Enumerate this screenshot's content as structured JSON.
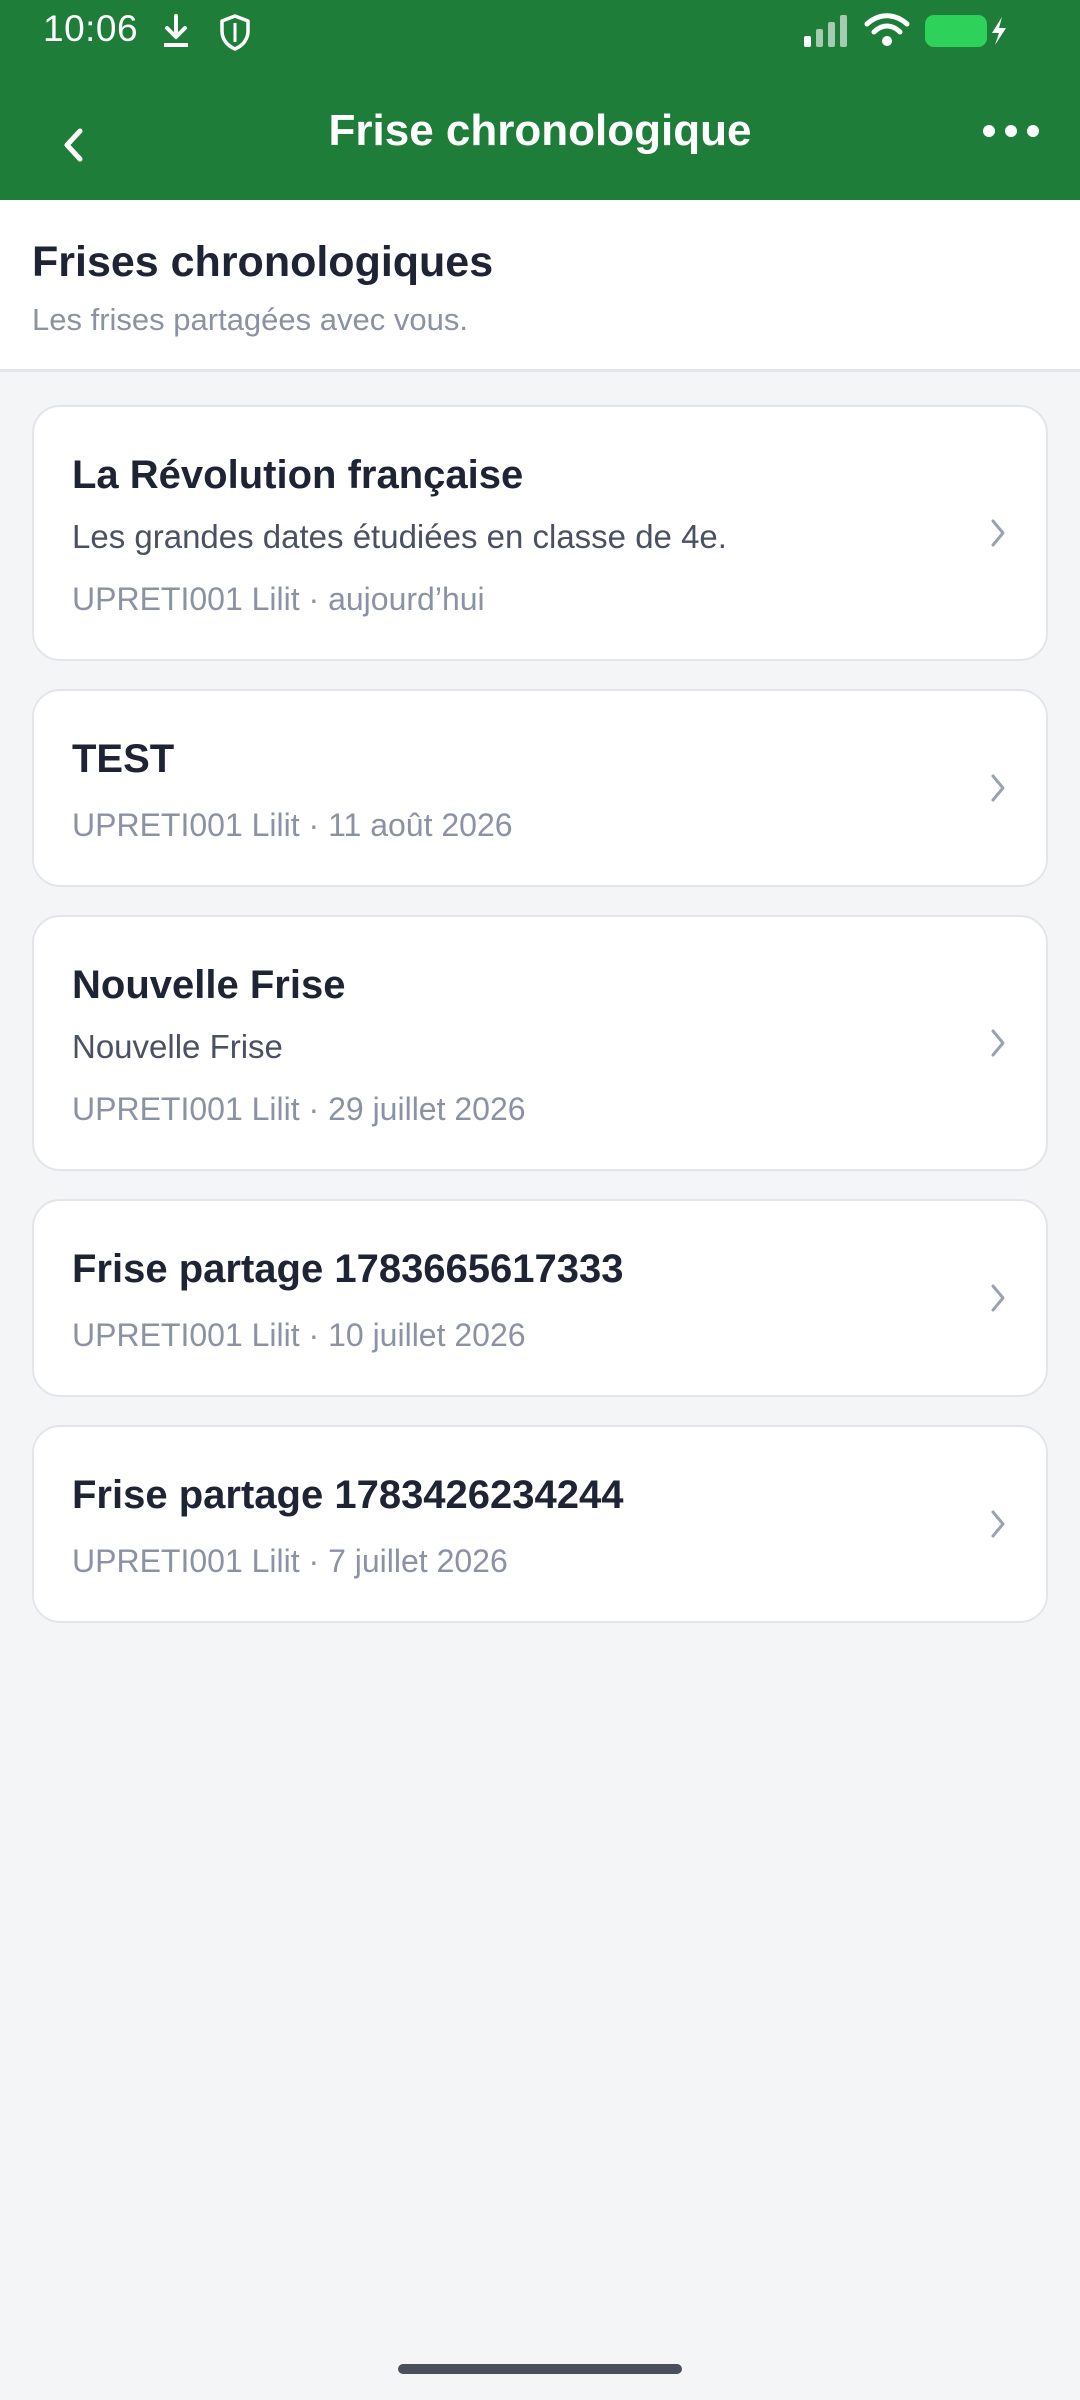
{
  "status_bar": {
    "time": "10:06",
    "icons": [
      "download-icon",
      "shield-icon",
      "signal-icon",
      "wifi-icon",
      "battery-charging-icon"
    ],
    "battery_color": "#2ed15a"
  },
  "app_bar": {
    "title": "Frise chronologique",
    "back_icon": "back-chevron-icon",
    "more_icon": "more-dots-icon",
    "background": "#1f7d3a"
  },
  "header": {
    "title": "Frises chronologiques",
    "subtitle": "Les frises partagées avec vous."
  },
  "timelines": [
    {
      "title": "La Révolution française",
      "description": "Les grandes dates étudiées en classe de 4e.",
      "meta": "UPRETI001 Lilit · aujourd’hui"
    },
    {
      "title": "TEST",
      "description": "",
      "meta": "UPRETI001 Lilit · 11 août 2026"
    },
    {
      "title": "Nouvelle Frise",
      "description": "Nouvelle Frise",
      "meta": "UPRETI001 Lilit · 29 juillet 2026"
    },
    {
      "title": "Frise partage 1783665617333",
      "description": "",
      "meta": "UPRETI001 Lilit · 10 juillet 2026"
    },
    {
      "title": "Frise partage 1783426234244",
      "description": "",
      "meta": "UPRETI001 Lilit · 7 juillet 2026"
    }
  ]
}
